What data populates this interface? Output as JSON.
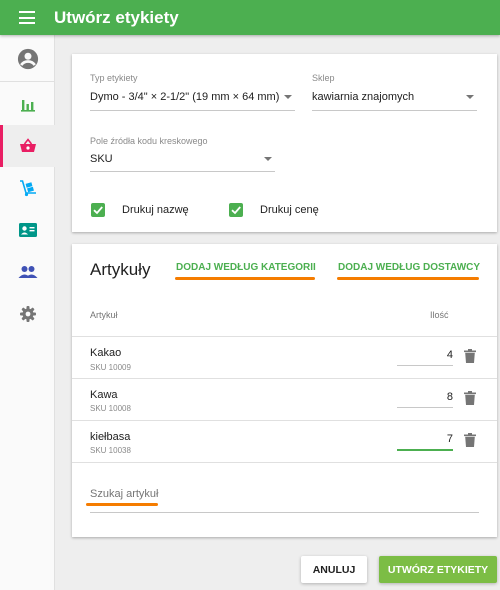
{
  "app": {
    "title": "Utwórz etykiety"
  },
  "sidebar": {
    "items": [
      {
        "icon": "account-circle-icon",
        "color": "#757575"
      },
      {
        "icon": "bar-chart-icon",
        "color": "#4caf50"
      },
      {
        "icon": "shopping-basket-icon",
        "color": "#e91e63",
        "active": true
      },
      {
        "icon": "dolly-icon",
        "color": "#03a9f4"
      },
      {
        "icon": "contact-card-icon",
        "color": "#009688"
      },
      {
        "icon": "people-icon",
        "color": "#3f51b5"
      },
      {
        "icon": "settings-icon",
        "color": "#757575"
      }
    ]
  },
  "settings": {
    "label_type": {
      "label": "Typ etykiety",
      "value": "Dymo - 3/4\" × 2-1/2\" (19 mm × 64 mm)"
    },
    "store": {
      "label": "Sklep",
      "value": "kawiarnia znajomych"
    },
    "barcode_source": {
      "label": "Pole źródła kodu kreskowego",
      "value": "SKU"
    },
    "print_name": {
      "label": "Drukuj nazwę",
      "checked": true
    },
    "print_price": {
      "label": "Drukuj cenę",
      "checked": true
    }
  },
  "items_section": {
    "title": "Artykuły",
    "add_by_category": "DODAJ WEDŁUG KATEGORII",
    "add_by_supplier": "DODAJ WEDŁUG DOSTAWCY",
    "col_item": "Artykuł",
    "col_qty": "Ilość",
    "rows": [
      {
        "name": "Kakao",
        "sku": "SKU 10009",
        "qty": "4"
      },
      {
        "name": "Kawa",
        "sku": "SKU 10008",
        "qty": "8"
      },
      {
        "name": "kiełbasa",
        "sku": "SKU 10038",
        "qty": "7"
      }
    ],
    "search_placeholder": "Szukaj artykuł"
  },
  "actions": {
    "cancel": "ANULUJ",
    "create": "UTWÓRZ ETYKIETY"
  },
  "colors": {
    "primary": "#4caf50",
    "accent_orange": "#f57c00",
    "create_button": "#7cbd45",
    "active_nav": "#e91e63"
  }
}
